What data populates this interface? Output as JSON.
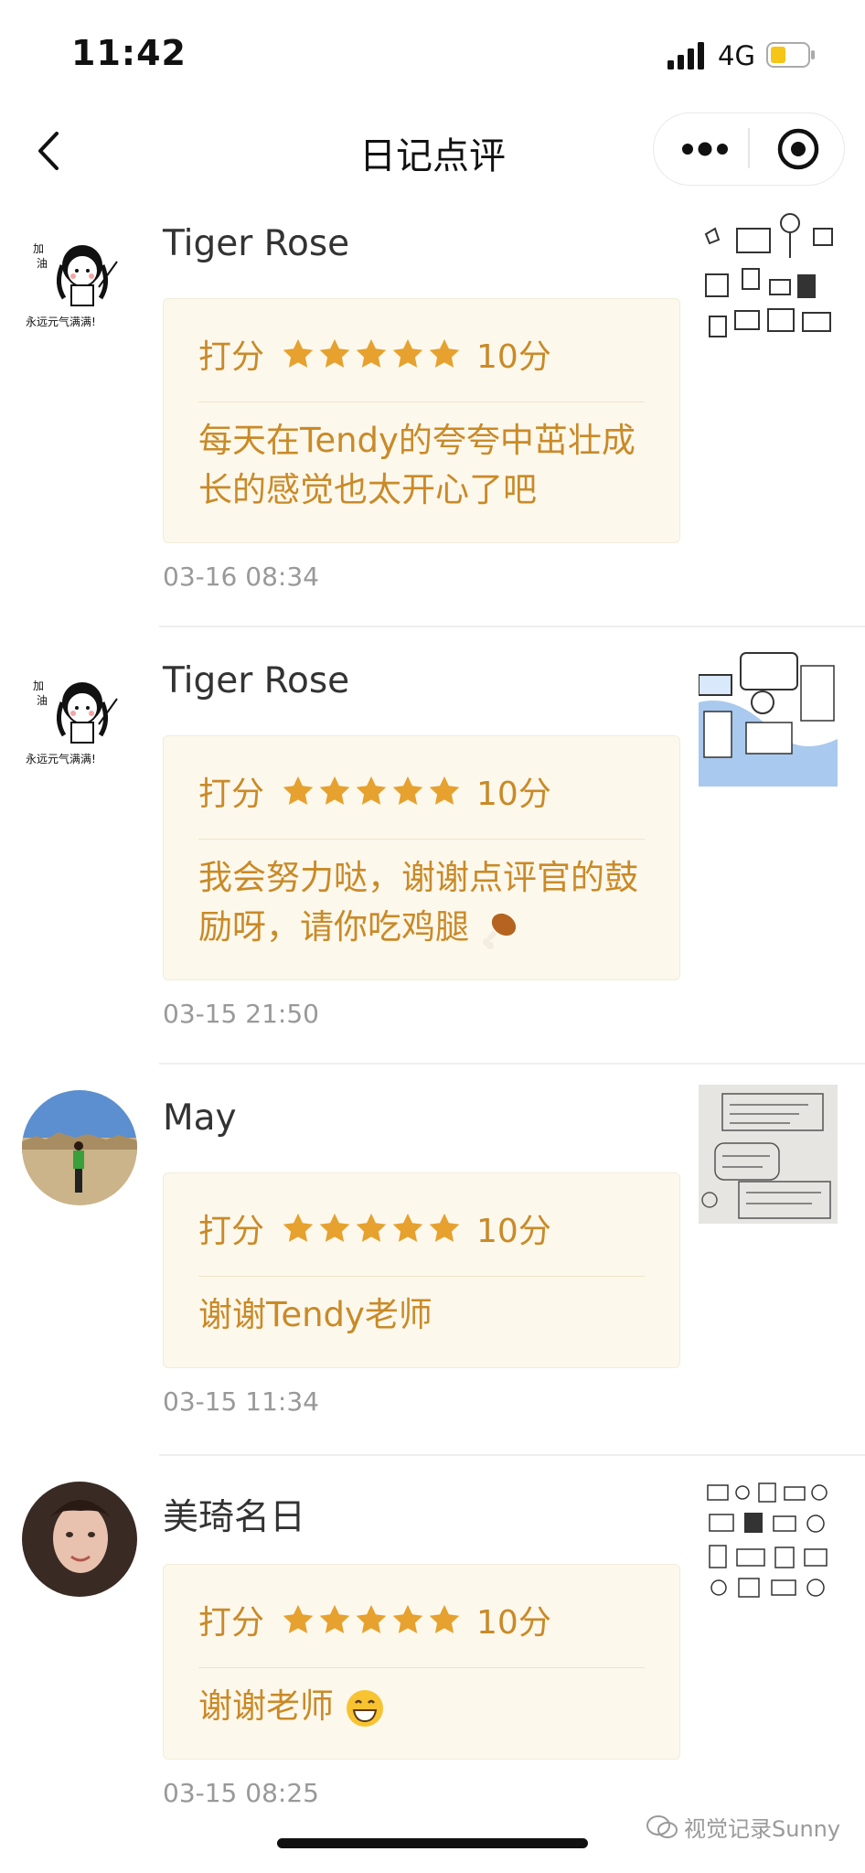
{
  "status_bar": {
    "time": "11:42",
    "network": "4G"
  },
  "nav": {
    "title": "日记点评"
  },
  "comments": [
    {
      "name": "Tiger Rose",
      "score_label": "打分",
      "stars": 5,
      "score_value": "10分",
      "text": "每天在Tendy的夸夸中茁壮成长的感觉也太开心了吧",
      "time": "03-16 08:34",
      "avatar_text": "永远元气满满!",
      "avatar_badge": "加油"
    },
    {
      "name": "Tiger Rose",
      "score_label": "打分",
      "stars": 5,
      "score_value": "10分",
      "text": "我会努力哒，谢谢点评官的鼓励呀，请你吃鸡腿",
      "text_emoji": "drumstick-emoji",
      "time": "03-15 21:50",
      "avatar_text": "永远元气满满!",
      "avatar_badge": "加油"
    },
    {
      "name": "May",
      "score_label": "打分",
      "stars": 5,
      "score_value": "10分",
      "text": "谢谢Tendy老师",
      "time": "03-15 11:34"
    },
    {
      "name": "美琦名日",
      "score_label": "打分",
      "stars": 5,
      "score_value": "10分",
      "text": "谢谢老师",
      "text_emoji": "grinning-face-emoji",
      "time": "03-15 08:25"
    }
  ],
  "watermark": "视觉记录Sunny",
  "colors": {
    "accent": "#c98a28",
    "card_bg": "#fdf8ec",
    "star": "#e6a12e"
  }
}
